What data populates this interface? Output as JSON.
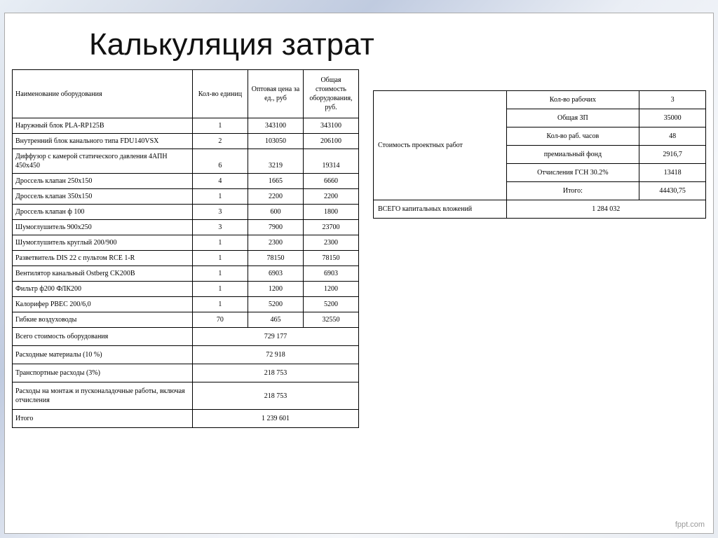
{
  "title": "Калькуляция затрат",
  "footer": "fppt.com",
  "left": {
    "headers": {
      "name": "Наименование оборудования",
      "qty": "Кол-во единиц",
      "price": "Оптовая цена за ед., руб",
      "total": "Общая стоимость оборудования, руб."
    },
    "rows": [
      {
        "name": "Наружный блок PLA-RP125B",
        "qty": "1",
        "price": "343100",
        "total": "343100"
      },
      {
        "name": "Внутренний блок канального типа FDU140VSX",
        "qty": "2",
        "price": "103050",
        "total": "206100"
      },
      {
        "name": "Диффузор с камерой статического давления 4АПН 450х450",
        "qty": "6",
        "price": "3219",
        "total": "19314"
      },
      {
        "name": "Дроссель клапан 250х150",
        "qty": "4",
        "price": "1665",
        "total": "6660"
      },
      {
        "name": "Дроссель клапан 350х150",
        "qty": "1",
        "price": "2200",
        "total": "2200"
      },
      {
        "name": "Дроссель клапан ф 100",
        "qty": "3",
        "price": "600",
        "total": "1800"
      },
      {
        "name": "Шумоглушитель 900х250",
        "qty": "3",
        "price": "7900",
        "total": "23700"
      },
      {
        "name": "Шумоглушитель круглый 200/900",
        "qty": "1",
        "price": "2300",
        "total": "2300"
      },
      {
        "name": "Разветвитель DIS 22 с пультом RCE 1-R",
        "qty": "1",
        "price": "78150",
        "total": "78150"
      },
      {
        "name": "Вентилятор канальный Ostberg CK200B",
        "qty": "1",
        "price": "6903",
        "total": "6903"
      },
      {
        "name": "Фильтр ф200 ФЛК200",
        "qty": "1",
        "price": "1200",
        "total": "1200"
      },
      {
        "name": "Калорифер PBEC 200/6,0",
        "qty": "1",
        "price": "5200",
        "total": "5200"
      },
      {
        "name": "Гибкие воздуховоды",
        "qty": "70",
        "price": "465",
        "total": "32550"
      }
    ],
    "summary": [
      {
        "label": "Всего стоимость оборудования",
        "value": "729 177"
      },
      {
        "label": "Расходные материалы (10 %)",
        "value": "72 918"
      },
      {
        "label": "Транспортные расходы (3%)",
        "value": "218 753"
      },
      {
        "label": "Расходы на монтаж и пусконаладочные работы, включая отчисления",
        "value": "218 753"
      },
      {
        "label": "Итого",
        "value": "1 239 601"
      }
    ]
  },
  "right": {
    "group_label": "Стоимость проектных работ",
    "items": [
      {
        "label": "Кол-во рабочих",
        "value": "3"
      },
      {
        "label": "Общая ЗП",
        "value": "35000"
      },
      {
        "label": "Кол-во раб. часов",
        "value": "48"
      },
      {
        "label": "премиальный фонд",
        "value": "2916,7"
      },
      {
        "label": "Отчисления ГСН 30.2%",
        "value": "13418"
      },
      {
        "label": "Итого:",
        "value": "44430,75"
      }
    ],
    "total_label": "ВСЕГО капитальных вложений",
    "total_value": "1 284 032"
  }
}
